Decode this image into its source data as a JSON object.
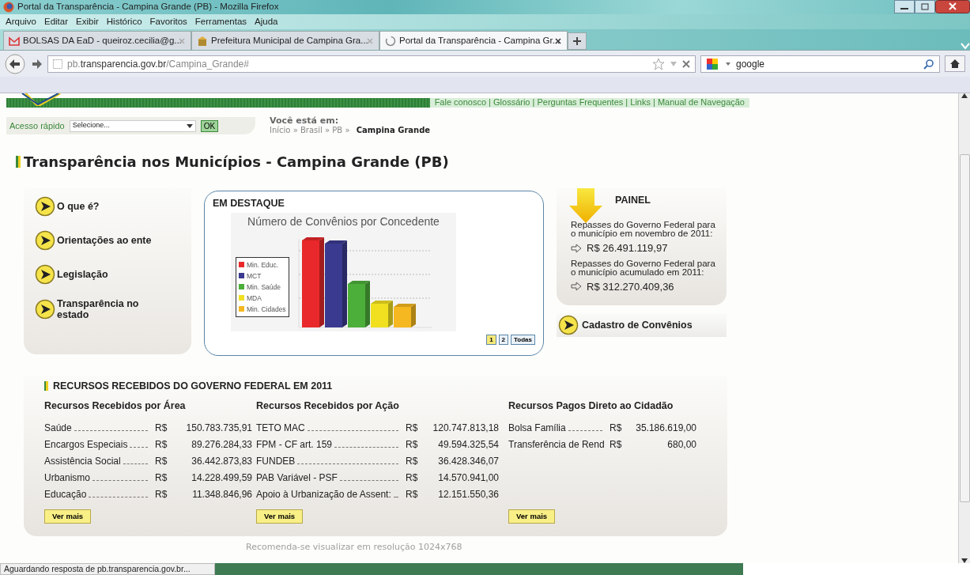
{
  "window": {
    "title": "Portal da Transparência - Campina Grande (PB) - Mozilla Firefox"
  },
  "menu": [
    "Arquivo",
    "Editar",
    "Exibir",
    "Histórico",
    "Favoritos",
    "Ferramentas",
    "Ajuda"
  ],
  "tabs": [
    {
      "label": "BOLSAS DA EaD - queiroz.cecilia@g...",
      "selected": false
    },
    {
      "label": "Prefeitura Municipal de Campina Gra...",
      "selected": false
    },
    {
      "label": "Portal da Transparência - Campina Gr...",
      "selected": true
    }
  ],
  "address_bar": {
    "url": "pb.**transparencia.gov.br**/Campina_Grande#"
  },
  "search": {
    "value": "google"
  },
  "page": {
    "top_links": "Fale conosco | Glossário | Perguntas Frequentes | Links | Manual de Navegação",
    "quick_access": {
      "label": "Acesso rápido",
      "placeholder": "Selecione...",
      "button": "OK"
    },
    "breadcrumb": {
      "label": "Você está em:",
      "separator": "»",
      "items": [
        {
          "label": "Início",
          "current": false
        },
        {
          "label": "Brasil",
          "current": false
        },
        {
          "label": "PB",
          "current": false
        },
        {
          "label": "Campina Grande",
          "current": true
        }
      ]
    },
    "heading": "Transparência nos Municípios - Campina Grande (PB)",
    "side_menu": [
      "O que é?",
      "Orientações ao ente",
      "Legislação",
      "Transparência no estado"
    ],
    "featured": {
      "title": "EM DESTAQUE",
      "chart_title": "Número de Convênios por Concedente",
      "legend": [
        {
          "label": "Min. Educ.",
          "color": "#e8282a"
        },
        {
          "label": "MCT",
          "color": "#3a3a90"
        },
        {
          "label": "Min. Saúde",
          "color": "#4caf3a"
        },
        {
          "label": "MDA",
          "color": "#f0e020"
        },
        {
          "label": "Min. Cidades",
          "color": "#f5b820"
        }
      ],
      "pager": [
        {
          "label": "1",
          "selected": true
        },
        {
          "label": "2",
          "selected": false
        },
        {
          "label": "Todas",
          "selected": false
        }
      ]
    },
    "painel": {
      "title": "PAINEL",
      "blocks": [
        {
          "text": "Repasses do Governo Federal para o município em novembro de 2011:",
          "amount": "R$ 26.491.119,97"
        },
        {
          "text": "Repasses do Governo Federal para o município acumulado em 2011:",
          "amount": "R$ 312.270.409,36"
        }
      ]
    },
    "cadastro": "Cadastro de Convênios",
    "recursos": {
      "title": "RECURSOS RECEBIDOS DO GOVERNO FEDERAL EM 2011",
      "columns": [
        {
          "title": "Recursos Recebidos por Área",
          "button": "Ver mais",
          "rows": [
            {
              "label": "Saúde",
              "currency": "R$",
              "value": "150.783.735,91"
            },
            {
              "label": "Encargos Especiais",
              "currency": "R$",
              "value": "89.276.284,33"
            },
            {
              "label": "Assistência Social",
              "currency": "R$",
              "value": "36.442.873,83"
            },
            {
              "label": "Urbanismo",
              "currency": "R$",
              "value": "14.228.499,59"
            },
            {
              "label": "Educação",
              "currency": "R$",
              "value": "11.348.846,96"
            }
          ]
        },
        {
          "title": "Recursos Recebidos por Ação",
          "button": "Ver mais",
          "rows": [
            {
              "label": "TETO MAC",
              "currency": "R$",
              "value": "120.747.813,18"
            },
            {
              "label": "FPM - CF art. 159",
              "currency": "R$",
              "value": "49.594.325,54"
            },
            {
              "label": "FUNDEB",
              "currency": "R$",
              "value": "36.428.346,07"
            },
            {
              "label": "PAB Variável - PSF",
              "currency": "R$",
              "value": "14.570.941,00"
            },
            {
              "label": "Apoio à Urbanização de Assent:",
              "currency": "R$",
              "value": "12.151.550,36"
            }
          ]
        },
        {
          "title": "Recursos Pagos Direto ao Cidadão",
          "button": "Ver mais",
          "rows": [
            {
              "label": "Bolsa Família",
              "currency": "R$",
              "value": "35.186.619,00"
            },
            {
              "label": "Transferência de Rend",
              "currency": "R$",
              "value": "680,00"
            }
          ]
        }
      ]
    },
    "footer_note": "Recomenda-se visualizar em resolução 1024x768"
  },
  "status_bar": "Aguardando resposta de pb.transparencia.gov.br..."
}
